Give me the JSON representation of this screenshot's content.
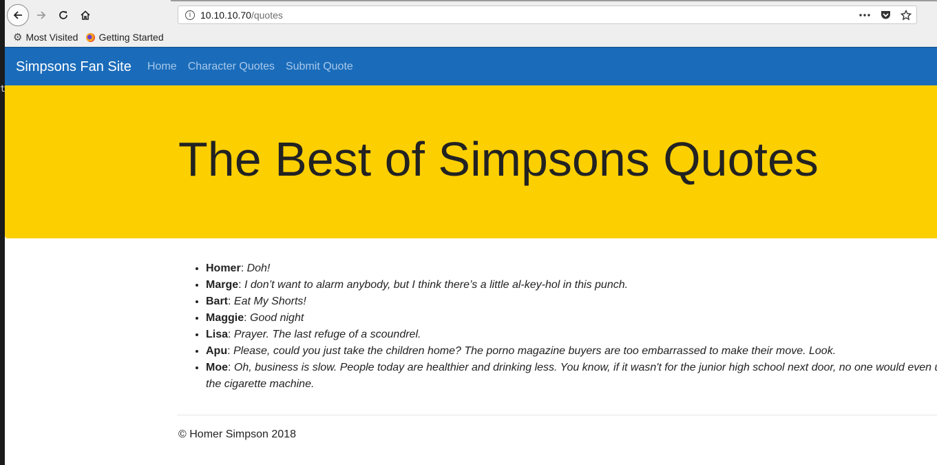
{
  "browser": {
    "url_host": "10.10.10.70",
    "url_path": "/quotes",
    "bookmarks": [
      {
        "label": "Most Visited",
        "icon": "gear-icon"
      },
      {
        "label": "Getting Started",
        "icon": "firefox-icon"
      }
    ]
  },
  "site": {
    "brand": "Simpsons Fan Site",
    "nav": [
      "Home",
      "Character Quotes",
      "Submit Quote"
    ],
    "hero_title": "The Best of Simpsons Quotes",
    "quotes": [
      {
        "character": "Homer",
        "text": "Doh!"
      },
      {
        "character": "Marge",
        "text": "I don’t want to alarm anybody, but I think there’s a little al-key-hol in this punch."
      },
      {
        "character": "Bart",
        "text": "Eat My Shorts!"
      },
      {
        "character": "Maggie",
        "text": "Good night"
      },
      {
        "character": "Lisa",
        "text": "Prayer. The last refuge of a scoundrel."
      },
      {
        "character": "Apu",
        "text": "Please, could you just take the children home? The porno magazine buyers are too embarrassed to make their move. Look."
      },
      {
        "character": "Moe",
        "text": "Oh, business is slow. People today are healthier and drinking less. You know, if it wasn't for the junior high school next door, no one would even use the cigarette machine."
      }
    ],
    "footer": "© Homer Simpson 2018"
  },
  "colors": {
    "navbar": "#1a6cba",
    "hero": "#fccf00",
    "nav_link": "#a8c8ea"
  },
  "stray_char": "t"
}
